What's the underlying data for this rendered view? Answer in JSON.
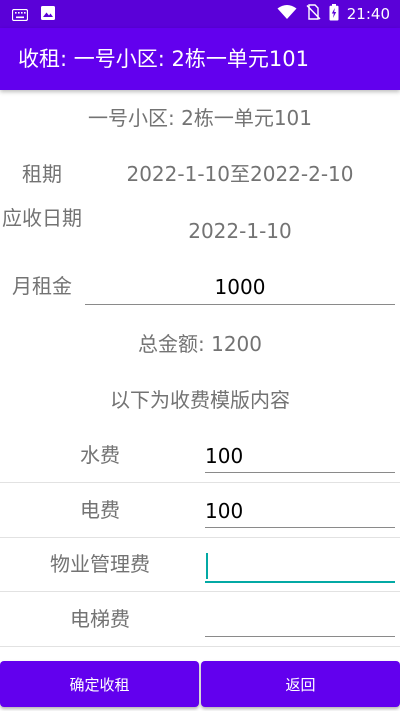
{
  "status_bar": {
    "time": "21:40",
    "icons": [
      "keyboard-icon",
      "image-icon",
      "wifi-icon",
      "no-sim-icon",
      "battery-charging-icon"
    ],
    "colors": {
      "background": "#5a01d8"
    }
  },
  "app_bar": {
    "title": "收租: 一号小区: 2栋一单元101",
    "color": "#6200ee"
  },
  "header": {
    "complex_room": "一号小区: 2栋一单元101"
  },
  "details": {
    "lease_label": "租期",
    "lease_value": "2022-1-10至2022-2-10",
    "due_date_label": "应收日期",
    "due_date_value": "2022-1-10",
    "monthly_rent_label": "月租金",
    "monthly_rent_value": "1000",
    "total": "总金额: 1200"
  },
  "template_section": {
    "title": "以下为收费模版内容",
    "fees": [
      {
        "label": "水费",
        "value": "100"
      },
      {
        "label": "电费",
        "value": "100"
      },
      {
        "label": "物业管理费",
        "value": ""
      },
      {
        "label": "电梯费",
        "value": ""
      }
    ]
  },
  "buttons": {
    "confirm": "确定收租",
    "back": "返回"
  },
  "colors": {
    "accent": "#6200ee",
    "focus": "#03a9a4",
    "text_secondary": "#737373"
  }
}
